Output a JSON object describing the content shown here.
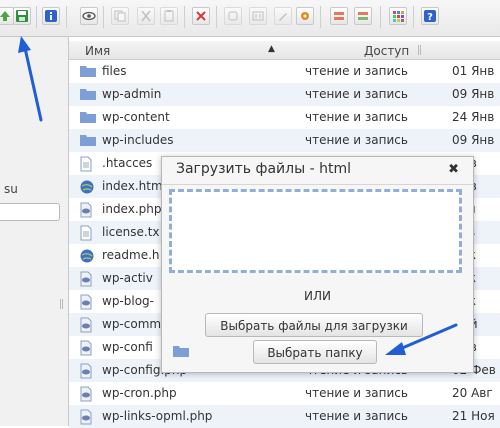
{
  "colors": {
    "accent": "#2f63c9",
    "folder": "#7e9fd6",
    "row_alt": "#eef3fa",
    "arrow": "#1f5ed6"
  },
  "toolbar": {
    "buttons": [
      {
        "name": "upload-icon",
        "color": "#4aa543"
      },
      {
        "name": "save-icon",
        "color": "#2f8f3f"
      },
      {
        "name": "info-icon",
        "color": "#2f63c9"
      },
      {
        "name": "view-icon",
        "color": "#555555"
      },
      {
        "name": "copy-icon",
        "color": "#aaaaaa"
      },
      {
        "name": "cut-icon",
        "color": "#aaaaaa"
      },
      {
        "name": "paste-icon",
        "color": "#aaaaaa"
      },
      {
        "name": "delete-icon",
        "color": "#d43c3c"
      },
      {
        "name": "duplicate-icon",
        "color": "#aaaaaa"
      },
      {
        "name": "rename-icon",
        "color": "#aaaaaa"
      },
      {
        "name": "edit-icon",
        "color": "#aaaaaa"
      },
      {
        "name": "archive-icon",
        "color": "#e28a1f"
      },
      {
        "name": "extract-icon",
        "color": "#e07a5f"
      },
      {
        "name": "grid-view-icon",
        "color": "#c94a8a"
      },
      {
        "name": "help-icon",
        "color": "#2f63c9"
      }
    ]
  },
  "sidebar": {
    "text": "su"
  },
  "list": {
    "header": {
      "name_label": "Имя",
      "access_label": "Доступ"
    },
    "rows": [
      {
        "name": "files",
        "access": "чтение и запись",
        "date": "01 Янв",
        "icon": "folder-icon"
      },
      {
        "name": "wp-admin",
        "access": "чтение и запись",
        "date": "09 Янв",
        "icon": "folder-icon"
      },
      {
        "name": "wp-content",
        "access": "чтение и запись",
        "date": "24 Янв",
        "icon": "folder-icon"
      },
      {
        "name": "wp-includes",
        "access": "чтение и запись",
        "date": "09 Янв",
        "icon": "folder-icon"
      },
      {
        "name": ".htacces",
        "access": "",
        "date": "Фев",
        "icon": "text-file-icon"
      },
      {
        "name": "index.htm",
        "access": "",
        "date": "Фев",
        "icon": "html-file-icon"
      },
      {
        "name": "index.php",
        "access": "",
        "date": "Сен",
        "icon": "php-file-icon"
      },
      {
        "name": "license.tx",
        "access": "",
        "date": "Янв",
        "icon": "text-file-icon"
      },
      {
        "name": "readme.h",
        "access": "",
        "date": "Дек",
        "icon": "html-file-icon"
      },
      {
        "name": "wp-activ",
        "access": "",
        "date": "Дек",
        "icon": "php-file-icon"
      },
      {
        "name": "wp-blog-",
        "access": "",
        "date": "Дек",
        "icon": "php-file-icon"
      },
      {
        "name": "wp-comm",
        "access": "",
        "date": "Май",
        "icon": "php-file-icon"
      },
      {
        "name": "wp-confi",
        "access": "",
        "date": "Фев",
        "icon": "php-file-icon"
      },
      {
        "name": "wp-config.php",
        "access": "чтение и запись",
        "date": "02 Фев",
        "icon": "php-file-icon"
      },
      {
        "name": "wp-cron.php",
        "access": "чтение и запись",
        "date": "20 Авг",
        "icon": "php-file-icon"
      },
      {
        "name": "wp-links-opml.php",
        "access": "чтение и запись",
        "date": "21 Ноя",
        "icon": "php-file-icon"
      }
    ]
  },
  "dialog": {
    "title": "Загрузить файлы - html",
    "close_glyph": "✖",
    "or_text": "ИЛИ",
    "select_files_label": "Выбрать файлы для загрузки",
    "select_folder_label": "Выбрать папку"
  }
}
